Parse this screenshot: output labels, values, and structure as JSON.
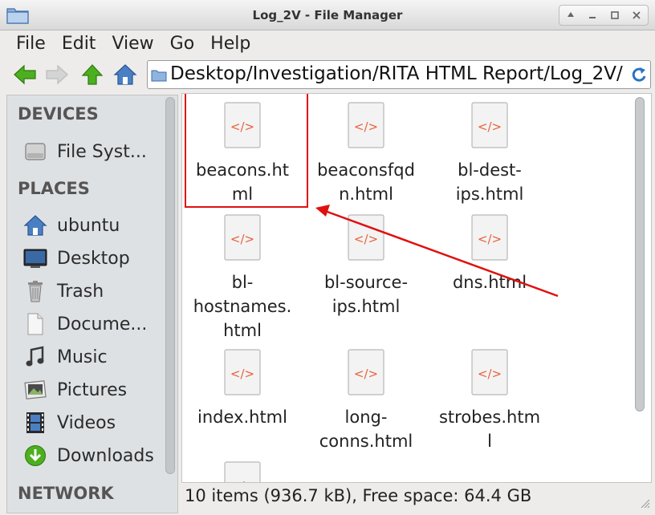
{
  "window": {
    "title": "Log_2V - File Manager"
  },
  "menu": [
    "File",
    "Edit",
    "View",
    "Go",
    "Help"
  ],
  "path": {
    "text": "Desktop/Investigation/RITA HTML Report/Log_2V/"
  },
  "sidebar": {
    "devices_header": "DEVICES",
    "places_header": "PLACES",
    "network_header": "NETWORK",
    "devices": [
      {
        "label": "File Syst...",
        "icon": "drive-icon"
      }
    ],
    "places": [
      {
        "label": "ubuntu",
        "icon": "home-icon"
      },
      {
        "label": "Desktop",
        "icon": "desktop-icon"
      },
      {
        "label": "Trash",
        "icon": "trash-icon"
      },
      {
        "label": "Docume...",
        "icon": "document-icon"
      },
      {
        "label": "Music",
        "icon": "music-icon"
      },
      {
        "label": "Pictures",
        "icon": "pictures-icon"
      },
      {
        "label": "Videos",
        "icon": "videos-icon"
      },
      {
        "label": "Downloads",
        "icon": "downloads-icon"
      }
    ]
  },
  "files": [
    {
      "line1": "beacons.ht",
      "line2": "ml",
      "line3": ""
    },
    {
      "line1": "beaconsfqd",
      "line2": "n.html",
      "line3": ""
    },
    {
      "line1": "bl-dest-",
      "line2": "ips.html",
      "line3": ""
    },
    {
      "line1": "bl-",
      "line2": "hostnames.",
      "line3": "html"
    },
    {
      "line1": "bl-source-",
      "line2": "ips.html",
      "line3": ""
    },
    {
      "line1": "dns.html",
      "line2": "",
      "line3": ""
    },
    {
      "line1": "index.html",
      "line2": "",
      "line3": ""
    },
    {
      "line1": "long-",
      "line2": "conns.html",
      "line3": ""
    },
    {
      "line1": "strobes.htm",
      "line2": "l",
      "line3": ""
    },
    {
      "line1": "",
      "line2": "",
      "line3": ""
    }
  ],
  "file_icon_glyph": "</>",
  "status": {
    "text": "10 items (936.7 kB), Free space: 64.4 GB"
  },
  "colors": {
    "annotation": "#e01010",
    "html_glyph": "#e8623a",
    "back_arrow": "#4caf1f",
    "folder_blue": "#4a7fc4"
  }
}
